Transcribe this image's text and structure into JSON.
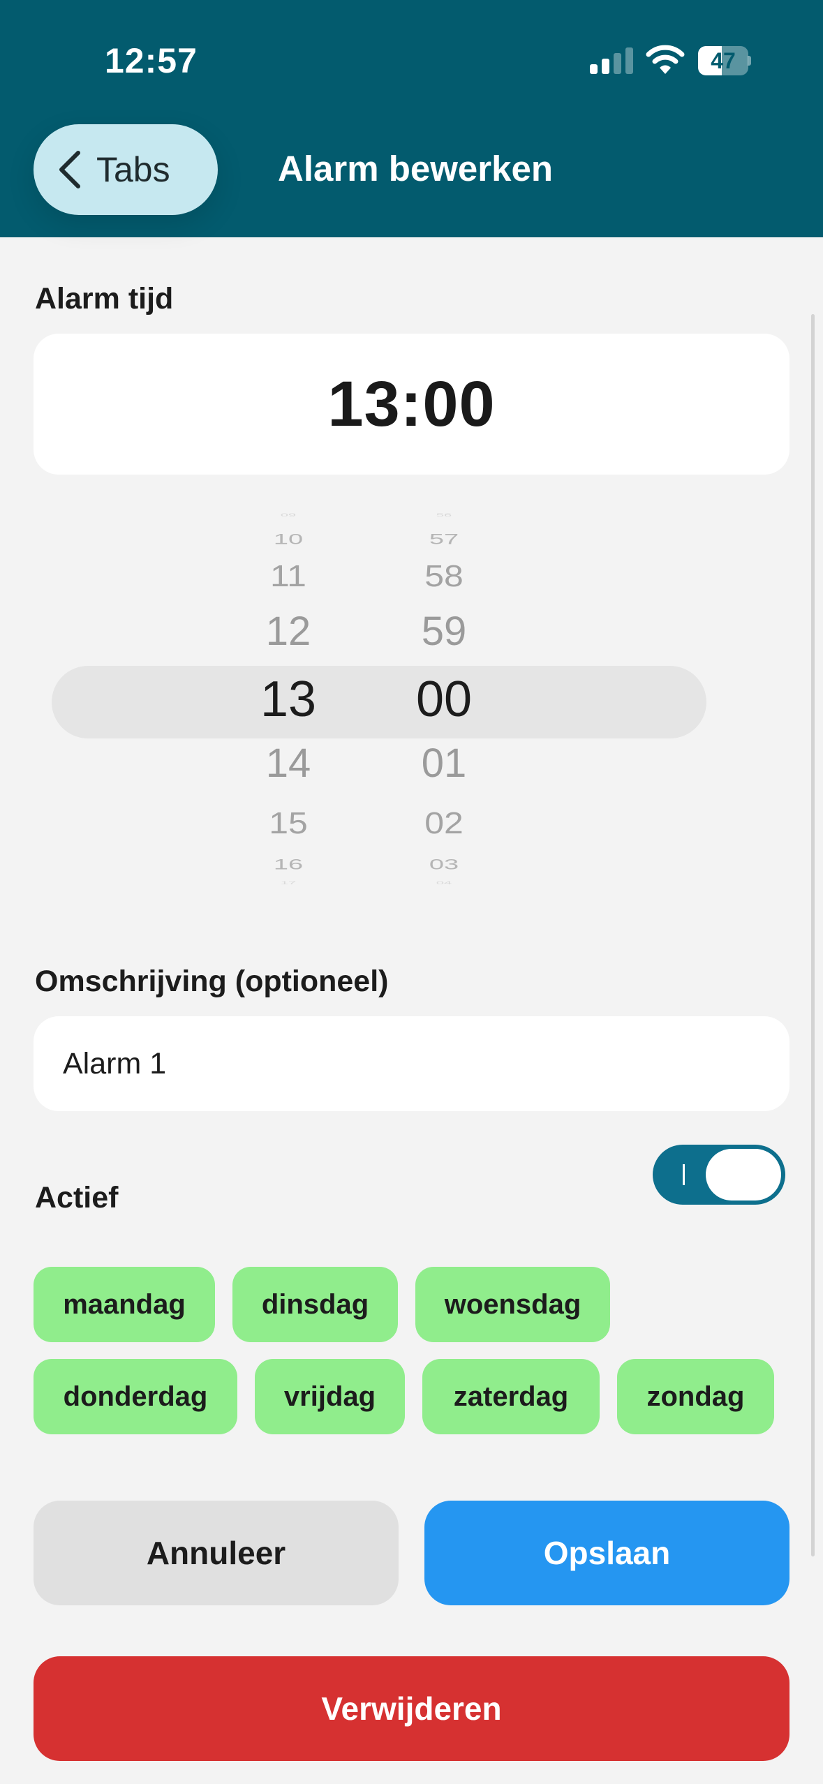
{
  "status_bar": {
    "time": "12:57",
    "battery_level": "47",
    "battery_fraction": 0.47,
    "icons": [
      "cellular-signal-icon",
      "wifi-icon",
      "battery-icon"
    ]
  },
  "nav": {
    "back_label": "Tabs",
    "title": "Alarm bewerken"
  },
  "alarm": {
    "section_label": "Alarm tijd",
    "time_display": "13:00"
  },
  "picker": {
    "hours": [
      "09",
      "10",
      "11",
      "12",
      "13",
      "14",
      "15",
      "16",
      "17"
    ],
    "minutes": [
      "56",
      "57",
      "58",
      "59",
      "00",
      "01",
      "02",
      "03",
      "04"
    ],
    "selected_hour": "13",
    "selected_minute": "00"
  },
  "description": {
    "label": "Omschrijving (optioneel)",
    "value": "Alarm 1"
  },
  "active": {
    "label": "Actief",
    "on": true
  },
  "days": [
    {
      "label": "maandag",
      "selected": true
    },
    {
      "label": "dinsdag",
      "selected": true
    },
    {
      "label": "woensdag",
      "selected": true
    },
    {
      "label": "donderdag",
      "selected": true
    },
    {
      "label": "vrijdag",
      "selected": true
    },
    {
      "label": "zaterdag",
      "selected": true
    },
    {
      "label": "zondag",
      "selected": true
    }
  ],
  "buttons": {
    "cancel": "Annuleer",
    "save": "Opslaan",
    "delete": "Verwijderen"
  },
  "colors": {
    "header": "#035b6e",
    "back_button": "#c6e8f0",
    "toggle_on": "#0d6f8d",
    "day_selected": "#90ed8c",
    "save": "#2596f1",
    "delete": "#d63131"
  }
}
